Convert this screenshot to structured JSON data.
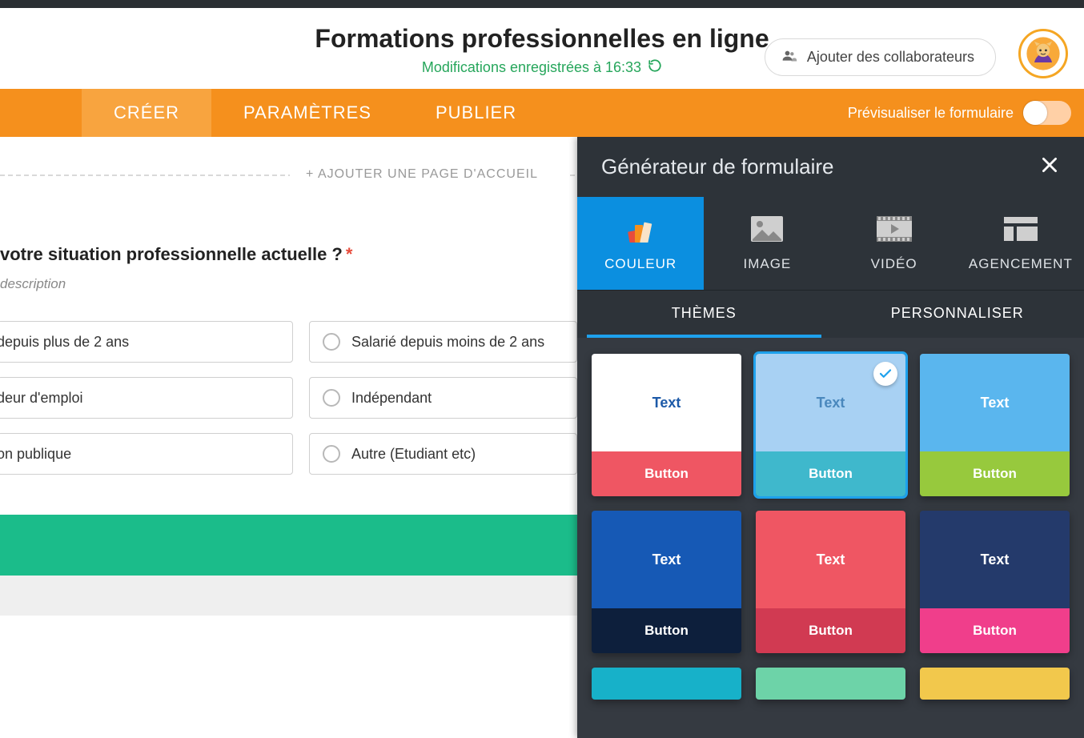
{
  "header": {
    "title": "Formations professionnelles en ligne",
    "saved_status": "Modifications enregistrées à 16:33",
    "add_collaborators": "Ajouter des collaborateurs"
  },
  "nav": {
    "tabs": [
      "CRÉER",
      "PARAMÈTRES",
      "PUBLIER"
    ],
    "active_index": 0,
    "preview_label": "Prévisualiser le formulaire"
  },
  "canvas": {
    "add_welcome_page": "+ AJOUTER UNE PAGE D'ACCUEIL",
    "question": {
      "title_suffix": "votre situation professionnelle actuelle ?",
      "required": true,
      "description_placeholder": "description",
      "options_col1": [
        "depuis plus de 2 ans",
        "deur d'emploi",
        "on publique"
      ],
      "options_col2": [
        "Salarié depuis moins de 2 ans",
        "Indépendant",
        "Autre (Etudiant etc)"
      ]
    }
  },
  "panel": {
    "title": "Générateur de formulaire",
    "tool_tabs": [
      "COULEUR",
      "IMAGE",
      "VIDÉO",
      "AGENCEMENT"
    ],
    "tool_active_index": 0,
    "subtabs": [
      "THÈMES",
      "PERSONNALISER"
    ],
    "subtab_active_index": 0,
    "theme_labels": {
      "text": "Text",
      "button": "Button"
    },
    "themes": [
      {
        "top_bg": "#ffffff",
        "top_color": "#1d5aa8",
        "bot_bg": "#ef5663",
        "bot_color": "#ffffff",
        "selected": false
      },
      {
        "top_bg": "#a8d1f3",
        "top_color": "#4a88bd",
        "bot_bg": "#3fb8cc",
        "bot_color": "#ffffff",
        "selected": true
      },
      {
        "top_bg": "#5ab6ee",
        "top_color": "#ffffff",
        "bot_bg": "#97c93d",
        "bot_color": "#ffffff",
        "selected": false
      },
      {
        "top_bg": "#1659b5",
        "top_color": "#ffffff",
        "bot_bg": "#0d1f3c",
        "bot_color": "#ffffff",
        "selected": false
      },
      {
        "top_bg": "#ef5663",
        "top_color": "#ffffff",
        "bot_bg": "#d13a52",
        "bot_color": "#ffffff",
        "selected": false
      },
      {
        "top_bg": "#243a6b",
        "top_color": "#ffffff",
        "bot_bg": "#f03e8b",
        "bot_color": "#ffffff",
        "selected": false
      }
    ]
  }
}
